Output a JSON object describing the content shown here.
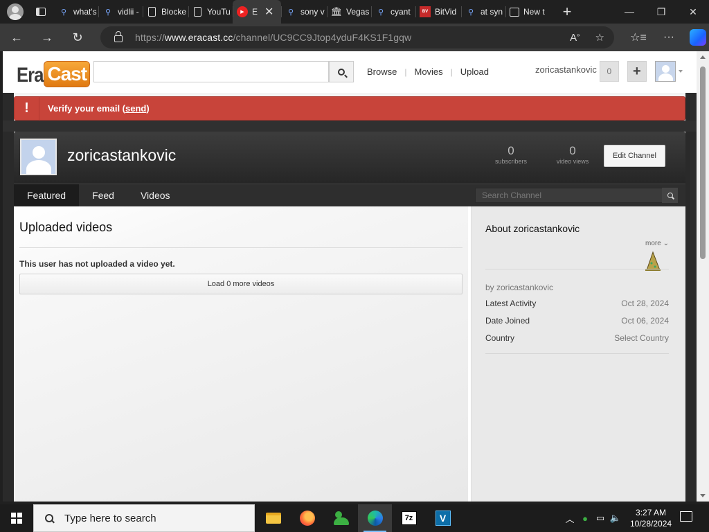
{
  "browser": {
    "tabs": [
      {
        "label": "what's",
        "icon": "search-icon"
      },
      {
        "label": "vidlii -",
        "icon": "search-icon"
      },
      {
        "label": "Blocke",
        "icon": "doc-icon"
      },
      {
        "label": "YouTu",
        "icon": "doc-icon"
      },
      {
        "label": "E",
        "icon": "youtube-icon",
        "active": true
      },
      {
        "label": "sony v",
        "icon": "search-icon"
      },
      {
        "label": "Vegas",
        "icon": "bank-icon"
      },
      {
        "label": "cyant",
        "icon": "search-icon"
      },
      {
        "label": "BitVid",
        "icon": "bitview-icon"
      },
      {
        "label": "at syn",
        "icon": "search-icon"
      },
      {
        "label": "New t",
        "icon": "newtab-icon"
      }
    ],
    "tab_close": "✕",
    "new_tab": "+",
    "url_prefix": "https://",
    "url_host": "www.eracast.cc",
    "url_path": "/channel/UC9CC9Jtop4yduF4KS1F1gqw"
  },
  "site": {
    "logo_left": "Era",
    "logo_right": "Cast",
    "nav": [
      "Browse",
      "Movies",
      "Upload"
    ],
    "username": "zoricastankovic",
    "notifications_count": "0",
    "plus": "+"
  },
  "alert": {
    "icon": "!",
    "text": "Verify your email (",
    "link": "send",
    "text_end": ")",
    "color": "#c8443a"
  },
  "channel": {
    "name": "zoricastankovic",
    "subscribers_count": "0",
    "subscribers_label": "subscribers",
    "views_count": "0",
    "views_label": "video views",
    "edit_button": "Edit Channel",
    "tabs": [
      "Featured",
      "Feed",
      "Videos"
    ],
    "search_placeholder": "Search Channel"
  },
  "main": {
    "section_title": "Uploaded videos",
    "empty_message": "This user has not uploaded a video yet.",
    "load_more": "Load 0 more videos"
  },
  "about": {
    "title": "About zoricastankovic",
    "more": "more",
    "by": "by zoricastankovic",
    "rows": [
      {
        "label": "Latest Activity",
        "value": "Oct 28, 2024"
      },
      {
        "label": "Date Joined",
        "value": "Oct 06, 2024"
      },
      {
        "label": "Country",
        "value": "Select Country"
      }
    ]
  },
  "taskbar": {
    "search_placeholder": "Type here to search",
    "apps": [
      "file-explorer-icon",
      "firefox-icon",
      "contacts-icon",
      "edge-icon",
      "7zip-icon",
      "vegas-icon"
    ],
    "app_7z_label": "7z",
    "app_vegas_label": "V",
    "time": "3:27 AM",
    "date": "10/28/2024"
  }
}
